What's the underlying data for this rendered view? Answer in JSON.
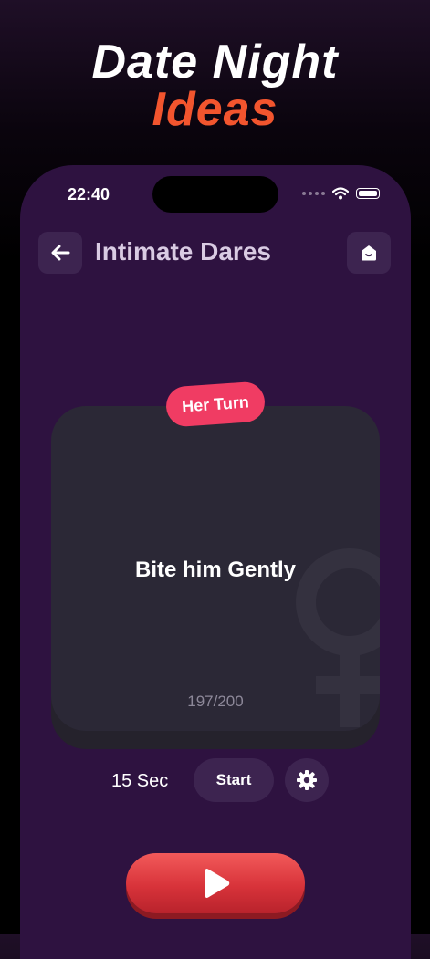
{
  "promo": {
    "line1": "Date Night",
    "line2": "Ideas"
  },
  "status_bar": {
    "time": "22:40"
  },
  "header": {
    "title": "Intimate Dares",
    "back_icon": "arrow-left-icon",
    "home_icon": "home-icon"
  },
  "card": {
    "turn_label": "Her Turn",
    "text": "Bite him Gently",
    "progress": "197/200",
    "watermark_icon": "venus-icon"
  },
  "controls": {
    "timer_label": "15 Sec",
    "start_label": "Start",
    "settings_icon": "gear-icon",
    "play_icon": "play-icon"
  },
  "colors": {
    "phone_bg": "#2e1240",
    "accent_orange": "#f2552e",
    "badge_pink": "#f03c63",
    "play_red": "#d8333a",
    "card_bg": "#2b2836"
  }
}
